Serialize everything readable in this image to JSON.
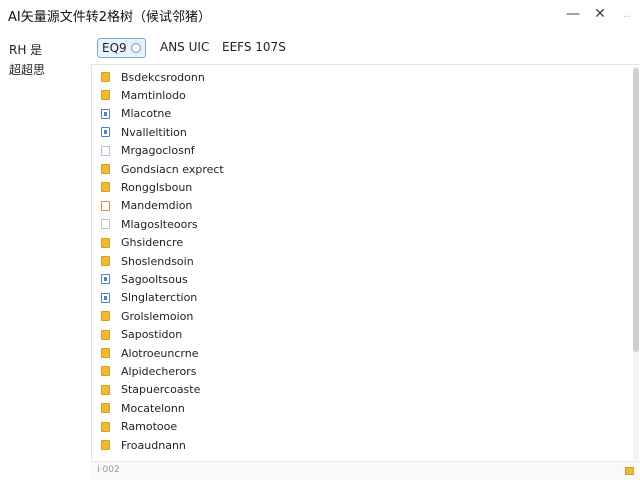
{
  "window": {
    "title": "AI矢量源文件转2格树（候试邻猪）",
    "minimize_label": "—",
    "close_label": "✕",
    "extra_label": "‥"
  },
  "sidebar": {
    "items": [
      {
        "label": "RH 是"
      },
      {
        "label": "超超思"
      }
    ]
  },
  "tabs": [
    {
      "label": "EQ9",
      "active": true
    },
    {
      "label": "ANS UIC",
      "active": false
    },
    {
      "label": "EEFS 107S",
      "active": false
    }
  ],
  "files": [
    {
      "name": "Bsdekcsrodonn",
      "icon": "folder"
    },
    {
      "name": "Mamtinlodo",
      "icon": "folder"
    },
    {
      "name": "Mlacotne",
      "icon": "blue"
    },
    {
      "name": "Nvalleltition",
      "icon": "blue"
    },
    {
      "name": "Mrgagoclosnf",
      "icon": "doc"
    },
    {
      "name": "Gondsiacn exprect",
      "icon": "folder"
    },
    {
      "name": "Rongglsboun",
      "icon": "folder"
    },
    {
      "name": "Mandemdion",
      "icon": "orange"
    },
    {
      "name": "Mlagoslteoors",
      "icon": "doc"
    },
    {
      "name": "Ghsidencre",
      "icon": "folder"
    },
    {
      "name": "Shoslendsoin",
      "icon": "folder"
    },
    {
      "name": "Sagooltsous",
      "icon": "blue"
    },
    {
      "name": "Slnglaterction",
      "icon": "blue"
    },
    {
      "name": "Grolslemoion",
      "icon": "folder"
    },
    {
      "name": "Sapostidon",
      "icon": "folder"
    },
    {
      "name": "Alotroeuncrne",
      "icon": "folder"
    },
    {
      "name": "Alpidecherors",
      "icon": "folder"
    },
    {
      "name": "Stapuercoaste",
      "icon": "folder"
    },
    {
      "name": "Mocatelonn",
      "icon": "folder"
    },
    {
      "name": "Ramotooe",
      "icon": "folder"
    },
    {
      "name": "Froaudnann",
      "icon": "folder"
    }
  ],
  "status": {
    "text": "I·002"
  }
}
